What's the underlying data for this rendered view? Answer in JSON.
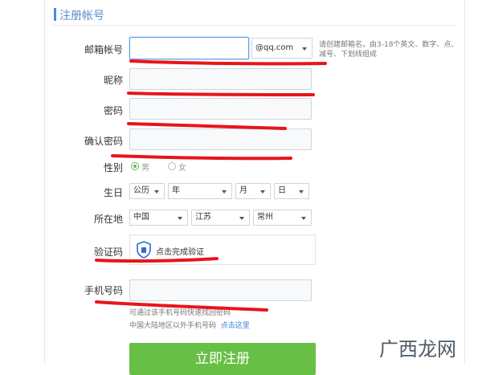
{
  "header": {
    "title": "注册帐号"
  },
  "form": {
    "email_label": "邮箱帐号",
    "email_value": "",
    "email_domain": "@qq.com",
    "email_help": "请创建邮箱名，由3-18个英文、数字、点、减号、下划线组成",
    "nickname_label": "昵称",
    "password_label": "密码",
    "confirm_label": "确认密码",
    "gender_label": "性别",
    "gender_options": [
      "男",
      "女"
    ],
    "gender_selected": "男",
    "birthday_label": "生日",
    "birthday_calendar": "公历",
    "birthday_year": "年",
    "birthday_month": "月",
    "birthday_day": "日",
    "location_label": "所在地",
    "location_country": "中国",
    "location_province": "江苏",
    "location_city": "常州",
    "captcha_label": "验证码",
    "captcha_text": "点击完成验证",
    "phone_label": "手机号码",
    "phone_note": "可通过该手机号码快速找回密码",
    "phone_other": "中国大陆地区以外手机号码",
    "phone_other_link": "点击这里",
    "submit_label": "立即注册"
  },
  "watermark": {
    "text": "广西龙网"
  },
  "colors": {
    "accent": "#4a8be6",
    "submit": "#68bf45",
    "scribble": "#e8141b"
  }
}
